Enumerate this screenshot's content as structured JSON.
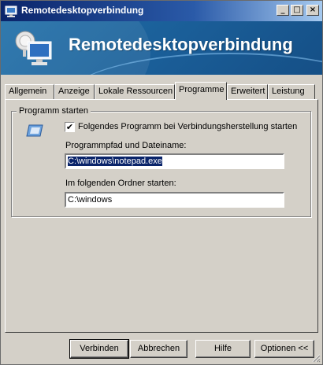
{
  "window": {
    "title": "Remotedesktopverbindung",
    "controls": {
      "minimize": "_",
      "maximize": "□",
      "close": "×"
    }
  },
  "banner": {
    "title": "Remotedesktopverbindung"
  },
  "tabs": [
    {
      "label": "Allgemein",
      "active": false
    },
    {
      "label": "Anzeige",
      "active": false
    },
    {
      "label": "Lokale Ressourcen",
      "active": false
    },
    {
      "label": "Programme",
      "active": true
    },
    {
      "label": "Erweitert",
      "active": false
    },
    {
      "label": "Leistung",
      "active": false
    }
  ],
  "programs": {
    "group_title": "Programm starten",
    "checkbox": {
      "label": "Folgendes Programm bei Verbindungsherstellung starten",
      "checked": true,
      "mark": "✔"
    },
    "path_label": "Programmpfad und Dateiname:",
    "path_value": "C:\\windows\\notepad.exe",
    "folder_label": "Im folgenden Ordner starten:",
    "folder_value": "C:\\windows"
  },
  "buttons": {
    "connect": "Verbinden",
    "cancel": "Abbrechen",
    "help": "Hilfe",
    "options": "Optionen <<"
  },
  "icons": {
    "title": "remote-desktop-icon",
    "banner": "monitor-satellite-icon",
    "program": "program-window-icon"
  }
}
